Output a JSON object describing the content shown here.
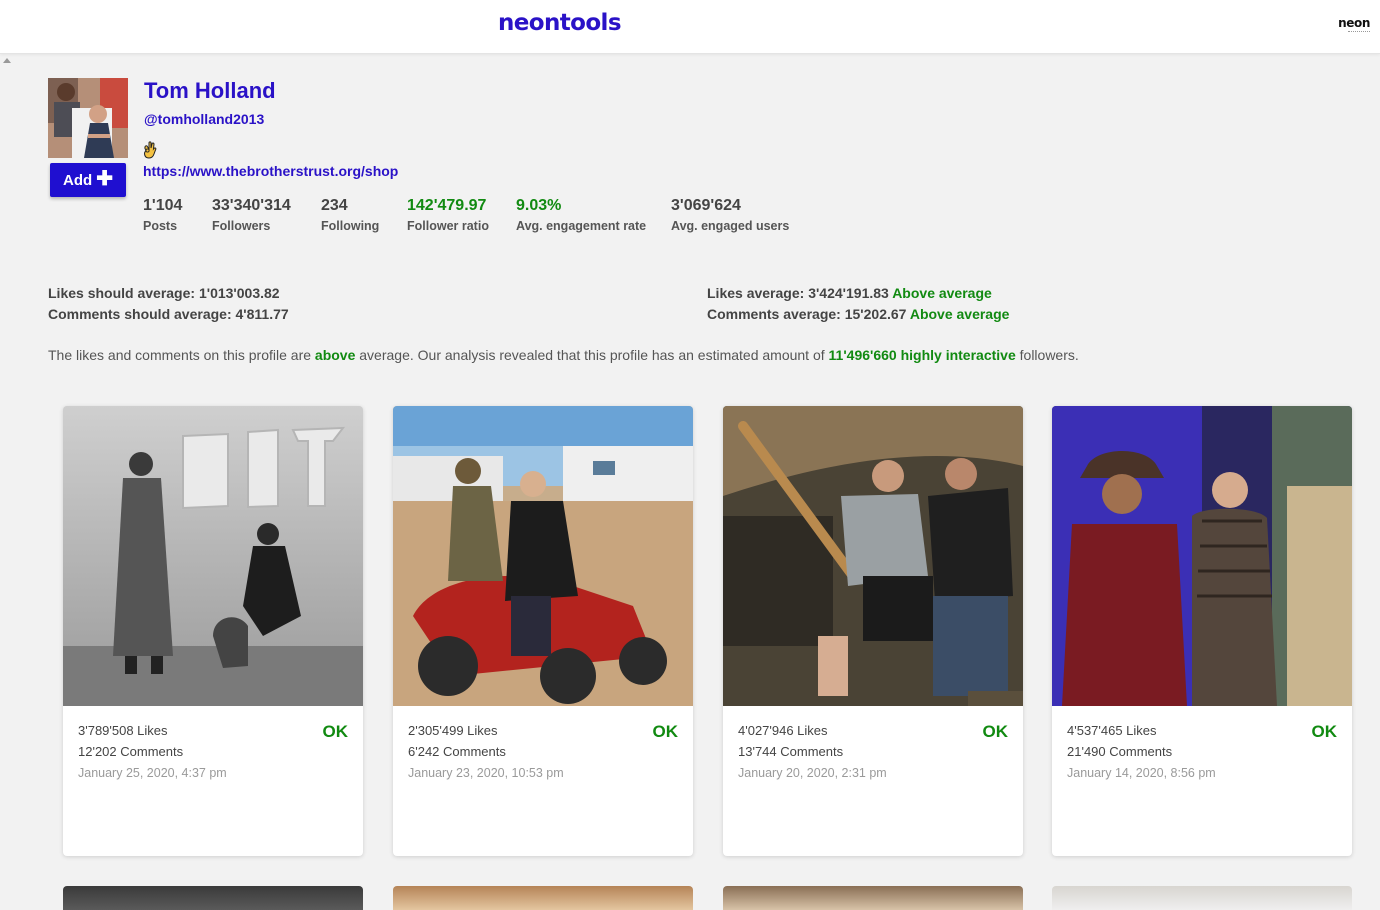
{
  "brand": {
    "logo": "neontools",
    "corner_logo": "neon"
  },
  "profile": {
    "name": "Tom Holland",
    "handle": "@tomholland2013",
    "link": "https://www.thebrotherstrust.org/shop",
    "add_button": "Add"
  },
  "stats": [
    {
      "value": "1'104",
      "label": "Posts"
    },
    {
      "value": "33'340'314",
      "label": "Followers"
    },
    {
      "value": "234",
      "label": "Following"
    },
    {
      "value": "142'479.97",
      "label": "Follower ratio"
    },
    {
      "value": "9.03%",
      "label": "Avg. engagement rate"
    },
    {
      "value": "3'069'624",
      "label": "Avg. engaged users"
    }
  ],
  "averages": {
    "likes_should_label": "Likes should average:",
    "likes_should_value": "1'013'003.82",
    "comments_should_label": "Comments should average:",
    "comments_should_value": "4'811.77",
    "likes_avg_label": "Likes average:",
    "likes_avg_value": "3'424'191.83",
    "likes_avg_status": "Above average",
    "comments_avg_label": "Comments average:",
    "comments_avg_value": "15'202.67",
    "comments_avg_status": "Above average"
  },
  "analysis": {
    "part1": "The likes and comments on this profile are",
    "highlight1": "above",
    "part2": "average. Our analysis revealed that this profile has an estimated amount of",
    "highlight2": "11'496'660 highly interactive",
    "part3": "followers."
  },
  "posts": [
    {
      "likes": "3'789'508 Likes",
      "comments": "12'202 Comments",
      "date": "January 25, 2020, 4:37 pm",
      "status": "OK"
    },
    {
      "likes": "2'305'499 Likes",
      "comments": "6'242 Comments",
      "date": "January 23, 2020, 10:53 pm",
      "status": "OK"
    },
    {
      "likes": "4'027'946 Likes",
      "comments": "13'744 Comments",
      "date": "January 20, 2020, 2:31 pm",
      "status": "OK"
    },
    {
      "likes": "4'537'465 Likes",
      "comments": "21'490 Comments",
      "date": "January 14, 2020, 8:56 pm",
      "status": "OK"
    }
  ],
  "colors": {
    "brand": "#2a12c7",
    "button": "#1f0fd0",
    "positive": "#118a11"
  }
}
